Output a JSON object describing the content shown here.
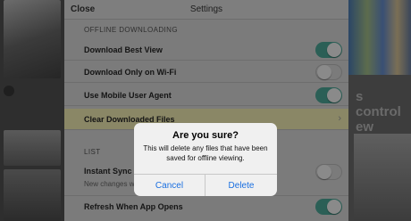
{
  "background": {
    "news_headline": "s control\new coins"
  },
  "settings": {
    "close_label": "Close",
    "title": "Settings",
    "offline_section_header": "OFFLINE DOWNLOADING",
    "rows": [
      {
        "label": "Download Best View",
        "toggle": "on"
      },
      {
        "label": "Download Only on Wi-Fi",
        "toggle": "off"
      },
      {
        "label": "Use Mobile User Agent",
        "toggle": "on"
      },
      {
        "label": "Clear Downloaded Files"
      }
    ],
    "list_section_header": "LIST",
    "list_rows": [
      {
        "label": "Instant Sync",
        "subtext": "New changes will sync",
        "toggle": "off"
      },
      {
        "label": "Refresh When App Opens",
        "toggle": "on"
      }
    ]
  },
  "alert": {
    "title": "Are you sure?",
    "message": "This will delete any files that have been saved for offline viewing.",
    "cancel_label": "Cancel",
    "delete_label": "Delete",
    "button_color": "#1a6fe0"
  }
}
